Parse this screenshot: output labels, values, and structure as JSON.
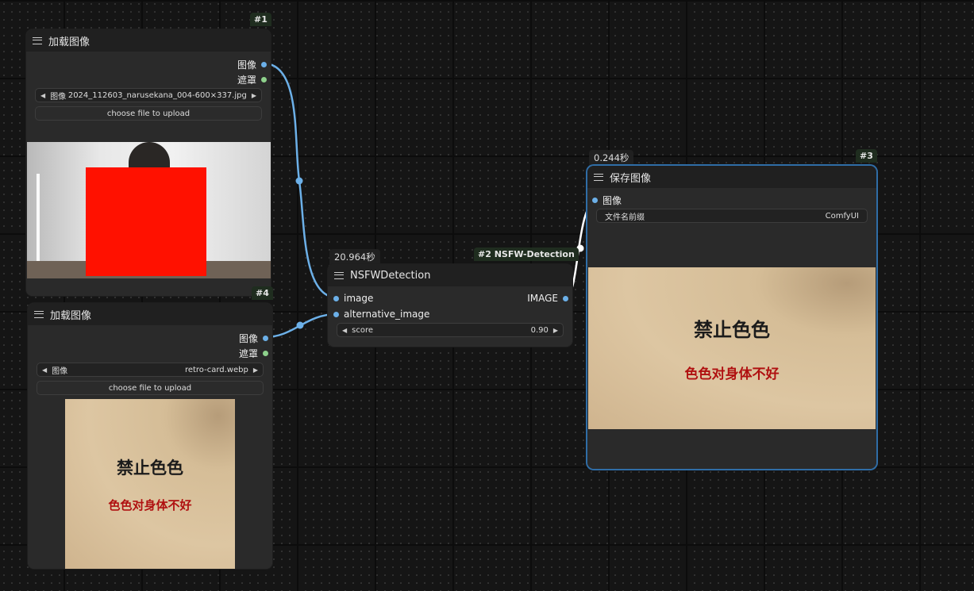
{
  "colors": {
    "link_image": "#6cb0e8",
    "link_white": "#ffffff",
    "selected_border": "#2f6da6",
    "slot_image": "#6cb0e8",
    "slot_mask": "#8ed18c"
  },
  "load_node_1": {
    "id_tag": "#1",
    "title": "加载图像",
    "outputs": {
      "image": "图像",
      "mask": "遮罩"
    },
    "image_widget": {
      "label": "图像",
      "value": "2024_112603_narusekana_004-600×337.jpg"
    },
    "upload_label": "choose file to upload"
  },
  "load_node_4": {
    "id_tag": "#4",
    "title": "加载图像",
    "outputs": {
      "image": "图像",
      "mask": "遮罩"
    },
    "image_widget": {
      "label": "图像",
      "value": "retro-card.webp"
    },
    "upload_label": "choose file to upload",
    "card": {
      "line1": "禁止色色",
      "line2": "色色对身体不好"
    }
  },
  "nsfw_node": {
    "timing": "20.964秒",
    "id_tag": "#2 NSFW-Detection",
    "title": "NSFWDetection",
    "inputs": {
      "image": "image",
      "alt": "alternative_image"
    },
    "output": "IMAGE",
    "score_widget": {
      "label": "score",
      "value": "0.90"
    }
  },
  "save_node": {
    "timing": "0.244秒",
    "id_tag": "#3",
    "title": "保存图像",
    "input": "图像",
    "prefix_widget": {
      "label": "文件名前缀",
      "value": "ComfyUI"
    },
    "card": {
      "line1": "禁止色色",
      "line2": "色色对身体不好"
    }
  },
  "icons": {
    "menu": "hamburger-menu-icon",
    "arrow_left": "◀",
    "arrow_right": "▶"
  }
}
